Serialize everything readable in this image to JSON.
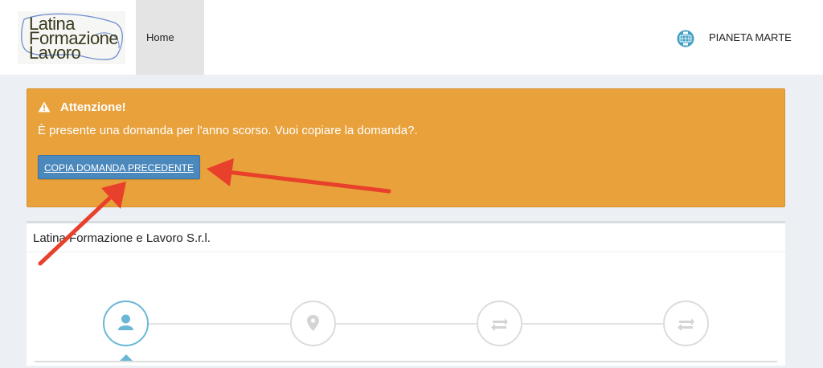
{
  "header": {
    "logo": {
      "line1": "Latina",
      "line2": "Formazione",
      "line3": "Lavoro"
    },
    "nav": {
      "home": "Home"
    },
    "user": {
      "name": "PIANETA MARTE",
      "icon": "user-avatar-icon"
    }
  },
  "alert": {
    "title": "Attenzione!",
    "message": "È presente una domanda per l'anno scorso. Vuoi copiare la domanda?.",
    "button": "COPIA DOMANDA PRECEDENTE",
    "icon": "warning-icon",
    "color": "#e8a13b"
  },
  "panel": {
    "title": "Latina Formazione e Lavoro S.r.l.",
    "steps": [
      {
        "icon": "user-icon",
        "active": true
      },
      {
        "icon": "location-pin-icon",
        "active": false
      },
      {
        "icon": "transfer-arrows-icon",
        "active": false
      },
      {
        "icon": "transfer-arrows-icon",
        "active": false
      }
    ]
  },
  "colors": {
    "accent": "#4b88bc",
    "warning": "#e8a13b",
    "annotation_arrow": "#e8402a",
    "active_step": "#6bb7d6"
  }
}
